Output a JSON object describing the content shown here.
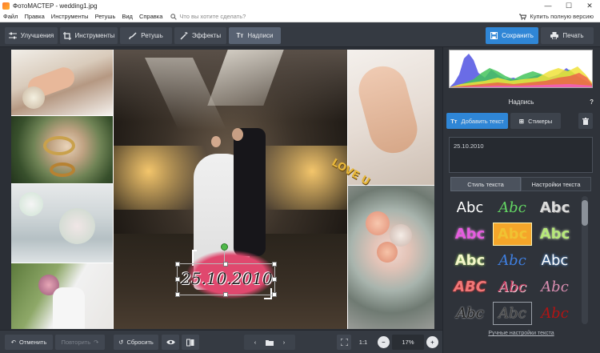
{
  "window": {
    "title": "ФотоМАСТЕР - wedding1.jpg",
    "min": "—",
    "max": "☐",
    "close": "✕"
  },
  "menu": {
    "items": [
      "Файл",
      "Правка",
      "Инструменты",
      "Ретушь",
      "Вид",
      "Справка"
    ],
    "search_placeholder": "Что вы хотите сделать?",
    "buy_label": "Купить полную версию"
  },
  "toolbar": {
    "tabs": [
      "Улучшения",
      "Инструменты",
      "Ретушь",
      "Эффекты",
      "Надписи"
    ],
    "active_tab": "Надписи",
    "save_label": "Сохранить",
    "print_label": "Печать"
  },
  "canvas": {
    "overlay_text": "25.10.2010",
    "love_text": "LOVE U"
  },
  "bottombar": {
    "undo_label": "Отменить",
    "redo_label": "Повторить",
    "reset_label": "Сбросить",
    "ratio_label": "1:1",
    "zoom_value": "17%"
  },
  "panel": {
    "title": "Надпись",
    "help": "?",
    "add_text_label": "Добавить текст",
    "stickers_label": "Стикеры",
    "text_value": "25.10.2010",
    "subtabs": [
      "Стиль текста",
      "Настройки текста"
    ],
    "active_subtab": "Стиль текста",
    "style_sample": "Abc",
    "style_sample_caps": "ABC",
    "manual_link": "Ручные настройки текста"
  },
  "colors": {
    "accent": "#2f86d6",
    "panel_bg": "#2f333a",
    "toolbar_bg": "#353a42",
    "overlay_pink": "#e0486e"
  }
}
